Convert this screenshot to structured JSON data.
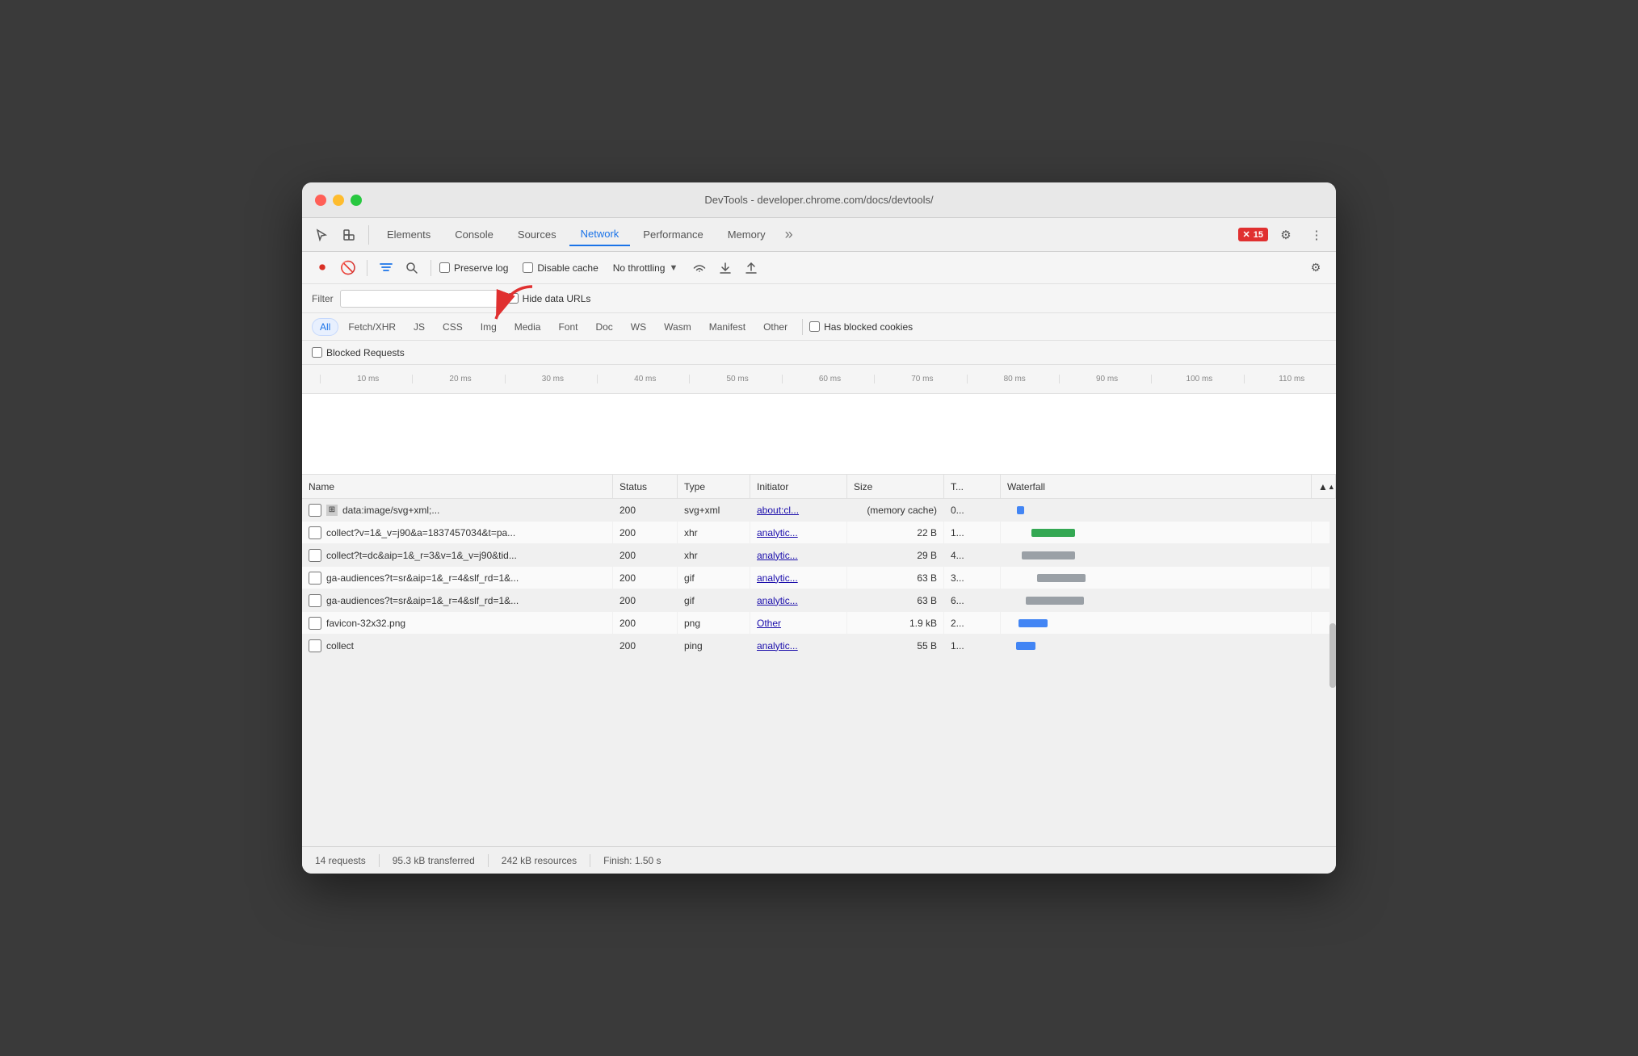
{
  "window": {
    "title": "DevTools - developer.chrome.com/docs/devtools/"
  },
  "titlebar": {
    "close": "●",
    "min": "●",
    "max": "●"
  },
  "devtools_tabs": {
    "tabs": [
      "Elements",
      "Console",
      "Sources",
      "Network",
      "Performance",
      "Memory"
    ],
    "active": "Network",
    "more": "»",
    "error_count": "15"
  },
  "toolbar": {
    "record_label": "⏺",
    "clear_label": "🚫",
    "filter_label": "⚙",
    "search_label": "🔍",
    "preserve_log": "Preserve log",
    "disable_cache": "Disable cache",
    "throttling": "No throttling",
    "import_label": "⬆",
    "export_label": "⬇",
    "settings_label": "⚙"
  },
  "filter_bar": {
    "filter_placeholder": "Filter",
    "hide_urls_label": "Hide data URLs"
  },
  "filter_types": {
    "types": [
      "All",
      "Fetch/XHR",
      "JS",
      "CSS",
      "Img",
      "Media",
      "Font",
      "Doc",
      "WS",
      "Wasm",
      "Manifest",
      "Other"
    ],
    "active": "All",
    "has_blocked_cookies": "Has blocked cookies"
  },
  "blocked_requests": {
    "label": "Blocked Requests"
  },
  "timeline": {
    "ticks": [
      "10 ms",
      "20 ms",
      "30 ms",
      "40 ms",
      "50 ms",
      "60 ms",
      "70 ms",
      "80 ms",
      "90 ms",
      "100 ms",
      "110 ms"
    ]
  },
  "table": {
    "columns": [
      "Name",
      "Status",
      "Type",
      "Initiator",
      "Size",
      "T...",
      "Waterfall",
      "▲"
    ],
    "rows": [
      {
        "name": "data:image/svg+xml;...",
        "status": "200",
        "type": "svg+xml",
        "initiator": "about:cl...",
        "size": "(memory cache)",
        "time": "0...",
        "wf_type": "blue",
        "wf_width": 3,
        "has_icon": true
      },
      {
        "name": "collect?v=1&_v=j90&a=1837457034&t=pa...",
        "status": "200",
        "type": "xhr",
        "initiator": "analytic...",
        "size": "22 B",
        "time": "1...",
        "wf_type": "green",
        "wf_width": 18,
        "has_icon": false
      },
      {
        "name": "collect?t=dc&aip=1&_r=3&v=1&_v=j90&tid...",
        "status": "200",
        "type": "xhr",
        "initiator": "analytic...",
        "size": "29 B",
        "time": "4...",
        "wf_type": "gray",
        "wf_width": 22,
        "has_icon": false
      },
      {
        "name": "ga-audiences?t=sr&aip=1&_r=4&slf_rd=1&...",
        "status": "200",
        "type": "gif",
        "initiator": "analytic...",
        "size": "63 B",
        "time": "3...",
        "wf_type": "gray",
        "wf_width": 20,
        "has_icon": false
      },
      {
        "name": "ga-audiences?t=sr&aip=1&_r=4&slf_rd=1&...",
        "status": "200",
        "type": "gif",
        "initiator": "analytic...",
        "size": "63 B",
        "time": "6...",
        "wf_type": "gray",
        "wf_width": 24,
        "has_icon": false
      },
      {
        "name": "favicon-32x32.png",
        "status": "200",
        "type": "png",
        "initiator": "Other",
        "size": "1.9 kB",
        "time": "2...",
        "wf_type": "blue",
        "wf_width": 12,
        "has_icon": false
      },
      {
        "name": "collect",
        "status": "200",
        "type": "ping",
        "initiator": "analytic...",
        "size": "55 B",
        "time": "1...",
        "wf_type": "blue",
        "wf_width": 8,
        "has_icon": false
      }
    ]
  },
  "status_bar": {
    "requests": "14 requests",
    "transferred": "95.3 kB transferred",
    "resources": "242 kB resources",
    "finish": "Finish: 1.50 s"
  }
}
